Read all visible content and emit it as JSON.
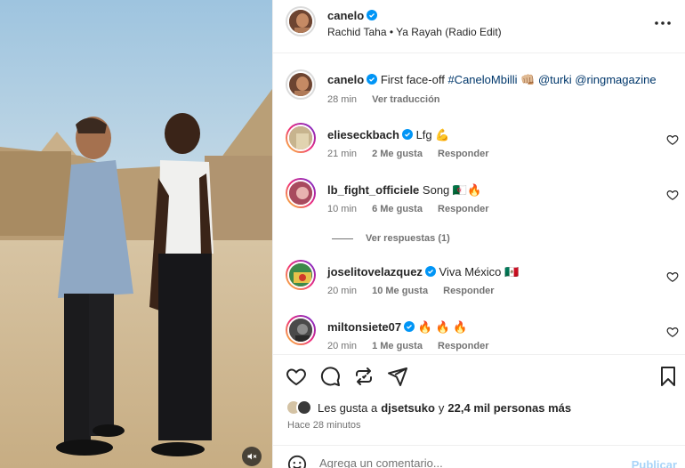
{
  "header": {
    "username": "canelo",
    "audio": "Rachid Taha • Ya Rayah (Radio Edit)",
    "more_icon": "more-horizontal-icon"
  },
  "caption": {
    "username": "canelo",
    "text_prefix": "First face-off",
    "hashtag": "#CaneloMbilli",
    "emoji": "👊🏼",
    "mention1": "@turki",
    "mention2": "@ringmagazine",
    "time": "28 min",
    "translate": "Ver traducción"
  },
  "comments": [
    {
      "username": "elieseckbach",
      "verified": true,
      "text": "Lfg 💪",
      "time": "21 min",
      "likes": "2 Me gusta",
      "reply": "Responder"
    },
    {
      "username": "lb_fight_officiele",
      "verified": false,
      "text": "Song 🇩🇿🔥",
      "time": "10 min",
      "likes": "6 Me gusta",
      "reply": "Responder"
    },
    {
      "username": "joselitovelazquez",
      "verified": true,
      "text": "Viva México 🇲🇽",
      "time": "20 min",
      "likes": "10 Me gusta",
      "reply": "Responder"
    },
    {
      "username": "miltonsiete07",
      "verified": true,
      "text": "🔥 🔥 🔥",
      "time": "20 min",
      "likes": "1 Me gusta",
      "reply": "Responder"
    }
  ],
  "replies": {
    "label": "Ver respuestas (1)"
  },
  "likes": {
    "prefix": "Les gusta a",
    "user": "djsetsuko",
    "middle": "y",
    "count": "22,4 mil personas más"
  },
  "time_ago": "Hace 28 minutos",
  "add_comment": {
    "placeholder": "Agrega un comentario...",
    "publish": "Publicar"
  },
  "colors": {
    "verified": "#0095f6",
    "link": "#00376b",
    "publish_disabled": "#a8d4f8"
  }
}
